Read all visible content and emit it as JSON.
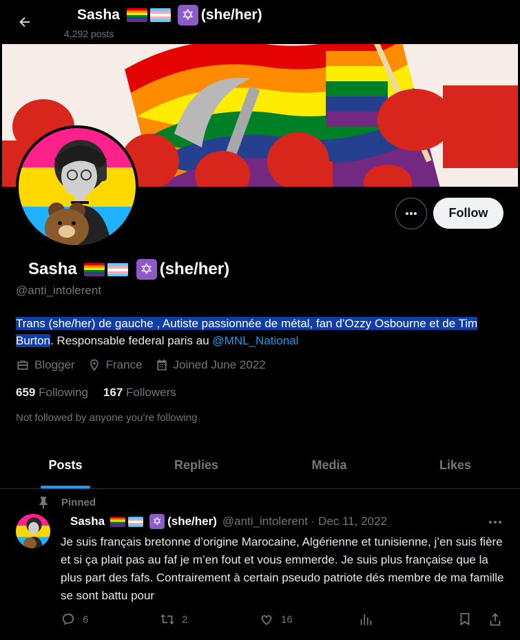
{
  "header": {
    "name": "Sasha",
    "pronouns": "(she/her)",
    "posts_count": "4,292 posts"
  },
  "profile": {
    "name": "Sasha",
    "pronouns": "(she/her)",
    "handle": "@anti_intolerent",
    "follow_label": "Follow",
    "bio_selected": "Trans (she/her) de gauche , Autiste passionnée de métal, fan d’Ozzy Osbourne et de Tim Burton",
    "bio_rest": ". Responsable federal paris au ",
    "bio_mention": "@MNL_National",
    "meta": {
      "profession": "Blogger",
      "location": "France",
      "joined": "Joined June 2022"
    },
    "following_count": "659",
    "following_label": "Following",
    "followers_count": "167",
    "followers_label": "Followers",
    "not_followed": "Not followed by anyone you’re following"
  },
  "tabs": [
    {
      "label": "Posts"
    },
    {
      "label": "Replies"
    },
    {
      "label": "Media"
    },
    {
      "label": "Likes"
    }
  ],
  "tweet": {
    "pinned_label": "Pinned",
    "name": "Sasha",
    "pronouns": "(she/her)",
    "handle_date": "@anti_intolerent · Dec 11, 2022",
    "text": "Je suis français bretonne d’origine Marocaine, Algérienne et tunisienne, j’en suis fière et si ça plait pas au faf je m’en fout et vous emmerde. Je suis plus française que la plus part des fafs. Contrairement à certain pseudo patriote dés membre de ma famille se sont battu pour",
    "replies": "6",
    "retweets": "2",
    "likes": "16"
  },
  "colors": {
    "accent": "#1d9bf0",
    "selection": "#0f3ea6",
    "muted": "#71767b",
    "star_badge": "#8e59c8"
  }
}
